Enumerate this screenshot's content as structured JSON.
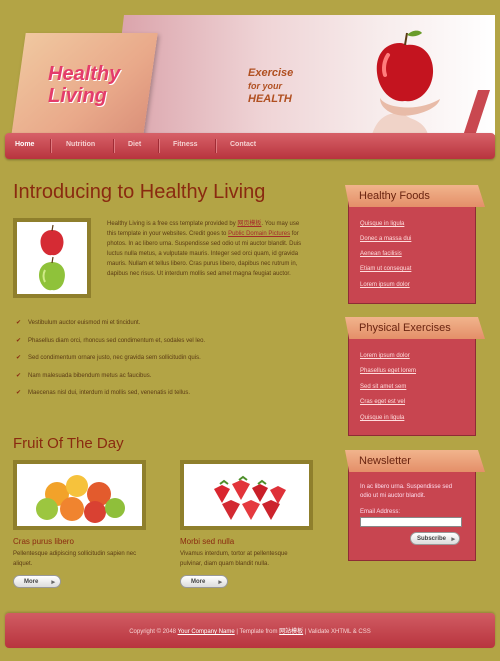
{
  "header": {
    "logo_line1": "Healthy",
    "logo_line2": "Living",
    "tag_line1": "Exercise",
    "tag_line2": "for your",
    "tag_line3": "HEALTH"
  },
  "nav": {
    "items": [
      {
        "label": "Home",
        "active": true
      },
      {
        "label": "Nutrition",
        "active": false
      },
      {
        "label": "Diet",
        "active": false
      },
      {
        "label": "Fitness",
        "active": false
      },
      {
        "label": "Contact",
        "active": false
      }
    ]
  },
  "main": {
    "title": "Introducing to Healthy Living",
    "intro": {
      "p1": "Healthy Living is a free css template provided by ",
      "link1": "网页模板",
      "p2": ". You may use this template in your websites. Credit goes to ",
      "link2": "Public Domain Pictures",
      "p3": " for photos. In ac libero urna. Suspendisse sed odio ut mi auctor blandit. Duis luctus nulla metus, a vulputate mauris. Integer sed orci quam, id gravida mauris. Nullam et tellus libero. Cras purus libero, dapibus nec rutrum in, dapibus nec risus. Ut interdum mollis sed amet magna feugiat auctor."
    },
    "bullets": [
      "Vestibulum auctor euismod mi et tincidunt.",
      "Phasellus diam orci, rhoncus sed condimentum et, sodales vel leo.",
      "Sed condimentum ornare justo, nec gravida sem sollicitudin quis.",
      "Nam malesuada bibendum metus ac faucibus.",
      "Maecenas nisl dui, interdum id mollis sed, venenatis id tellus."
    ],
    "fruit_title": "Fruit Of The Day",
    "fruits": [
      {
        "title": "Cras purus libero",
        "text": "Pellentesque adipiscing sollicitudin sapien nec aliquet.",
        "button": "More"
      },
      {
        "title": "Morbi sed nulla",
        "text": "Vivamus interdum, tortor at pellentesque pulvinar, diam quam blandit nulla.",
        "button": "More"
      }
    ]
  },
  "sidebar": {
    "healthy_foods": {
      "title": "Healthy Foods",
      "links": [
        "Quisque in ligula",
        "Donec a massa dui",
        "Aenean facilisis",
        "Etiam ut consequat",
        "Lorem ipsum dolor"
      ]
    },
    "physical_exercises": {
      "title": "Physical Exercises",
      "links": [
        "Lorem ipsum dolor",
        "Phasellus eget lorem",
        "Sed sit amet sem",
        "Cras eget est vel",
        "Quisque in ligula"
      ]
    },
    "newsletter": {
      "title": "Newsletter",
      "text": "In ac libero urna. Suspendisse sed odio ut mi auctor blandit.",
      "email_label": "Email Address:",
      "email_value": "",
      "button": "Subscribe"
    }
  },
  "footer": {
    "copyright": "Copyright © 2048",
    "company": "Your Company Name",
    "template_from": " | Template from ",
    "template_link": "网站模板",
    "validate": " | Validate XHTML & CSS"
  },
  "colors": {
    "background": "#b3a445",
    "nav": "#c84550",
    "heading": "#8a2a10",
    "logo": "#e43c6b"
  }
}
